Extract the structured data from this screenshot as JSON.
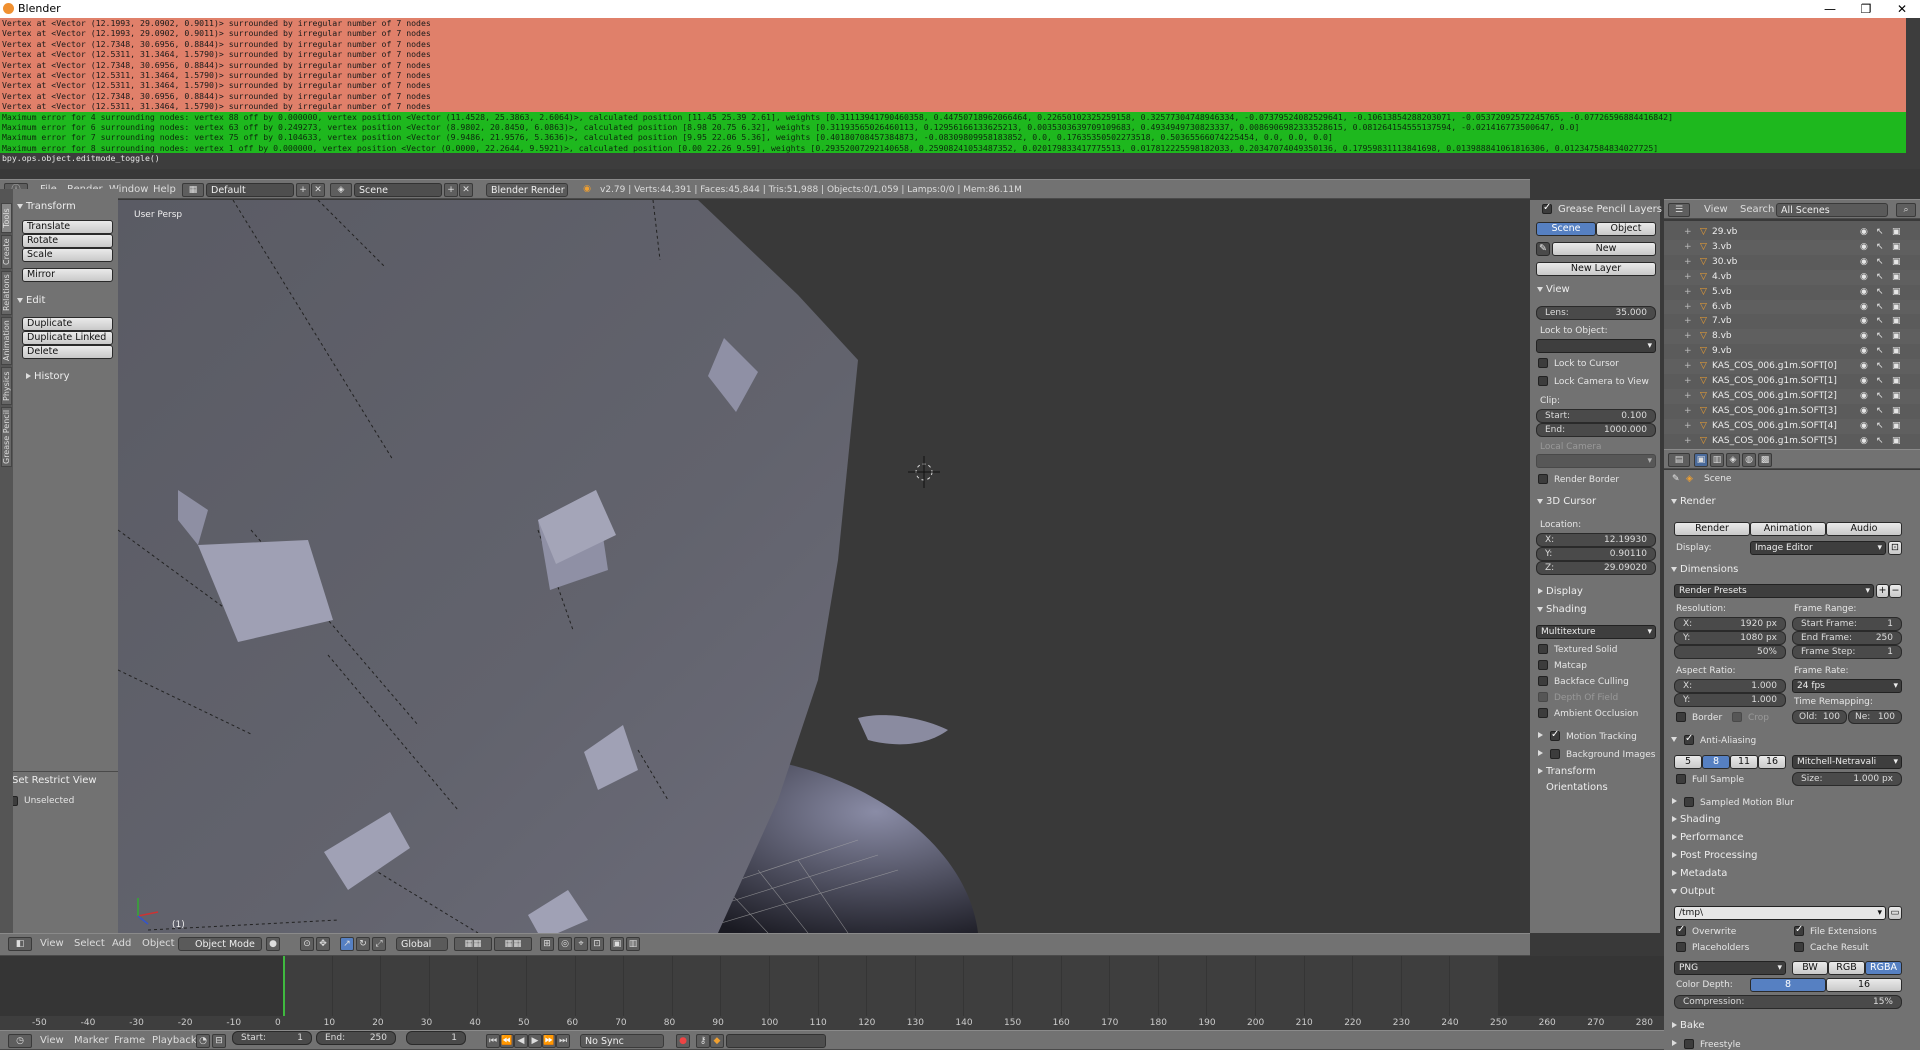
{
  "window": {
    "title": "Blender",
    "controls": [
      "—",
      "❐",
      "✕"
    ]
  },
  "console": {
    "lines": [
      {
        "k": "er",
        "t": "Vertex at <Vector (12.1993, 29.0902, 0.9011)> surrounded by irregular number of 7 nodes"
      },
      {
        "k": "er",
        "t": "Vertex at <Vector (12.1993, 29.0902, 0.9011)> surrounded by irregular number of 7 nodes"
      },
      {
        "k": "er",
        "t": "Vertex at <Vector (12.7348, 30.6956, 0.8844)> surrounded by irregular number of 7 nodes"
      },
      {
        "k": "er",
        "t": "Vertex at <Vector (12.5311, 31.3464, 1.5790)> surrounded by irregular number of 7 nodes"
      },
      {
        "k": "er",
        "t": "Vertex at <Vector (12.7348, 30.6956, 0.8844)> surrounded by irregular number of 7 nodes"
      },
      {
        "k": "er",
        "t": "Vertex at <Vector (12.5311, 31.3464, 1.5790)> surrounded by irregular number of 7 nodes"
      },
      {
        "k": "er",
        "t": "Vertex at <Vector (12.5311, 31.3464, 1.5790)> surrounded by irregular number of 7 nodes"
      },
      {
        "k": "er",
        "t": "Vertex at <Vector (12.7348, 30.6956, 0.8844)> surrounded by irregular number of 7 nodes"
      },
      {
        "k": "er",
        "t": "Vertex at <Vector (12.5311, 31.3464, 1.5790)> surrounded by irregular number of 7 nodes"
      },
      {
        "k": "wr",
        "t": "Maximum error for 4 surrounding nodes: vertex 88 off by 0.000000, vertex position <Vector (11.4528, 25.3863, 2.6064)>, calculated position [11.45 25.39 2.61], weights [0.31113941790460358, 0.44750718962066464, 0.22650102325259158, 0.32577304748946334, -0.07379524082529641, -0.10613854288203071, -0.05372092572245765, -0.07726596884416842]"
      },
      {
        "k": "wr",
        "t": "Maximum error for 6 surrounding nodes: vertex 63 off by 0.249273, vertex position <Vector (8.9802, 20.8450, 6.0863)>, calculated position [8.98 20.75 6.32], weights [0.31193565026460113, 0.12956166133625213, 0.0035303639709109683, 0.4934949730823337, 0.0086906982333528615, 0.081264154555137594, -0.021416773500647, 0.0]"
      },
      {
        "k": "wr",
        "t": "Maximum error for 7 surrounding nodes: vertex 75 off by 0.104633, vertex position <Vector (9.9486, 21.9576, 5.3636)>, calculated position [9.95 22.06 5.36], weights [0.40180708457384873, -0.08309809958183852, 0.0, 0.17635350502273518, 0.50365566074225454, 0.0, 0.0, 0.0]"
      },
      {
        "k": "wr",
        "t": "Maximum error for 8 surrounding nodes: vertex 1 off by 0.000000, vertex position <Vector (0.0000, 22.2644, 9.5921)>, calculated position [0.00 22.26 9.59], weights [0.29352007292140658, 0.25908241053487352, 0.020179833417775513, 0.017812225598182033, 0.20347074049350136, 0.17959831113841698, 0.013988841061816306, 0.012347584834027725]"
      },
      {
        "k": "in",
        "t": "bpy.ops.object.editmode_toggle()"
      }
    ]
  },
  "info_header": {
    "menus": [
      "File",
      "Render",
      "Window",
      "Help"
    ],
    "layout": "Default",
    "scene": "Scene",
    "engine": "Blender Render",
    "stats": "v2.79 | Verts:44,391 | Faces:45,844 | Tris:51,988 | Objects:0/1,059 | Lamps:0/0 | Mem:86.11M"
  },
  "tool_tabs": [
    "Tools",
    "Create",
    "Relations",
    "Animation",
    "Physics",
    "Grease Pencil"
  ],
  "toolshelf": {
    "transform_title": "Transform",
    "transform": [
      "Translate",
      "Rotate",
      "Scale"
    ],
    "mirror": "Mirror",
    "edit_title": "Edit",
    "edit": [
      "Duplicate",
      "Duplicate Linked",
      "Delete"
    ],
    "history_title": "History",
    "restrict_title": "Set Restrict View",
    "unselected": "Unselected"
  },
  "viewport": {
    "label": "User Persp",
    "frame": "(1)"
  },
  "npanel": {
    "gp_title": "Grease Pencil Layers",
    "scene_tab": "Scene",
    "object_tab": "Object",
    "new": "New",
    "new_layer": "New Layer",
    "view_title": "View",
    "lens_k": "Lens:",
    "lens_v": "35.000",
    "lock_obj": "Lock to Object:",
    "lock_cursor": "Lock to Cursor",
    "lock_cam": "Lock Camera to View",
    "clip": "Clip:",
    "start_k": "Start:",
    "start_v": "0.100",
    "end_k": "End:",
    "end_v": "1000.000",
    "local_cam": "Local Camera",
    "render_border": "Render Border",
    "cursor_title": "3D Cursor",
    "location": "Location:",
    "x_k": "X:",
    "x_v": "12.19930",
    "y_k": "Y:",
    "y_v": "0.90110",
    "z_k": "Z:",
    "z_v": "29.09020",
    "display_title": "Display",
    "shading_title": "Shading",
    "shading_mode": "Multitexture",
    "shading_opts": [
      "Textured Solid",
      "Matcap",
      "Backface Culling",
      "Depth Of Field",
      "Ambient Occlusion"
    ],
    "motion_tracking": "Motion Tracking",
    "bg_images": "Background Images",
    "transform_orient": "Transform Orientations"
  },
  "outliner": {
    "menus": [
      "View",
      "Search"
    ],
    "filter": "All Scenes",
    "rows": [
      "29.vb",
      "3.vb",
      "30.vb",
      "4.vb",
      "5.vb",
      "6.vb",
      "7.vb",
      "8.vb",
      "9.vb",
      "KAS_COS_006.g1m.SOFT[0]",
      "KAS_COS_006.g1m.SOFT[1]",
      "KAS_COS_006.g1m.SOFT[2]",
      "KAS_COS_006.g1m.SOFT[3]",
      "KAS_COS_006.g1m.SOFT[4]",
      "KAS_COS_006.g1m.SOFT[5]"
    ]
  },
  "props": {
    "scene": "Scene",
    "render_title": "Render",
    "render_btn": "Render",
    "anim_btn": "Animation",
    "audio_btn": "Audio",
    "display_k": "Display:",
    "display_v": "Image Editor",
    "dim_title": "Dimensions",
    "presets": "Render Presets",
    "resolution": "Resolution:",
    "res_x_k": "X:",
    "res_x_v": "1920 px",
    "res_y_k": "Y:",
    "res_y_v": "1080 px",
    "res_pct": "50%",
    "frame_range": "Frame Range:",
    "sf_k": "Start Frame:",
    "sf_v": "1",
    "ef_k": "End Frame:",
    "ef_v": "250",
    "fs_k": "Frame Step:",
    "fs_v": "1",
    "aspect": "Aspect Ratio:",
    "ax_k": "X:",
    "ax_v": "1.000",
    "ay_k": "Y:",
    "ay_v": "1.000",
    "frame_rate": "Frame Rate:",
    "fps": "24 fps",
    "border": "Border",
    "crop": "Crop",
    "time_remap": "Time Remapping:",
    "old_k": "Old:",
    "old_v": "100",
    "new_k": "Ne:",
    "new_v": "100",
    "aa_title": "Anti-Aliasing",
    "aa_levels": [
      "5",
      "8",
      "11",
      "16"
    ],
    "aa_filter": "Mitchell-Netravali",
    "full_sample": "Full Sample",
    "size_k": "Size:",
    "size_v": "1.000 px",
    "collapsed": [
      "Sampled Motion Blur",
      "Shading",
      "Performance",
      "Post Processing",
      "Metadata"
    ],
    "output_title": "Output",
    "path": "/tmp\\",
    "overwrite": "Overwrite",
    "file_ext": "File Extensions",
    "placeholders": "Placeholders",
    "cache_result": "Cache Result",
    "format": "PNG",
    "bw": "BW",
    "rgb": "RGB",
    "rgba": "RGBA",
    "color_depth": "Color Depth:",
    "depth8": "8",
    "depth16": "16",
    "compression": "Compression:",
    "comp_v": "15%",
    "bake": "Bake",
    "freestyle": "Freestyle"
  },
  "view3d_header": {
    "menus": [
      "View",
      "Select",
      "Add",
      "Object"
    ],
    "mode": "Object Mode",
    "orientation": "Global"
  },
  "timeline": {
    "ticks": [
      "-50",
      "-40",
      "-30",
      "-20",
      "-10",
      "0",
      "10",
      "20",
      "30",
      "40",
      "50",
      "60",
      "70",
      "80",
      "90",
      "100",
      "110",
      "120",
      "130",
      "140",
      "150",
      "160",
      "170",
      "180",
      "190",
      "200",
      "210",
      "220",
      "230",
      "240",
      "250",
      "260",
      "270",
      "280"
    ],
    "current_frame": 0
  },
  "timeline_header": {
    "menus": [
      "View",
      "Marker",
      "Frame",
      "Playback"
    ],
    "start_k": "Start:",
    "start_v": "1",
    "end_k": "End:",
    "end_v": "250",
    "cur_v": "1",
    "sync": "No Sync"
  }
}
